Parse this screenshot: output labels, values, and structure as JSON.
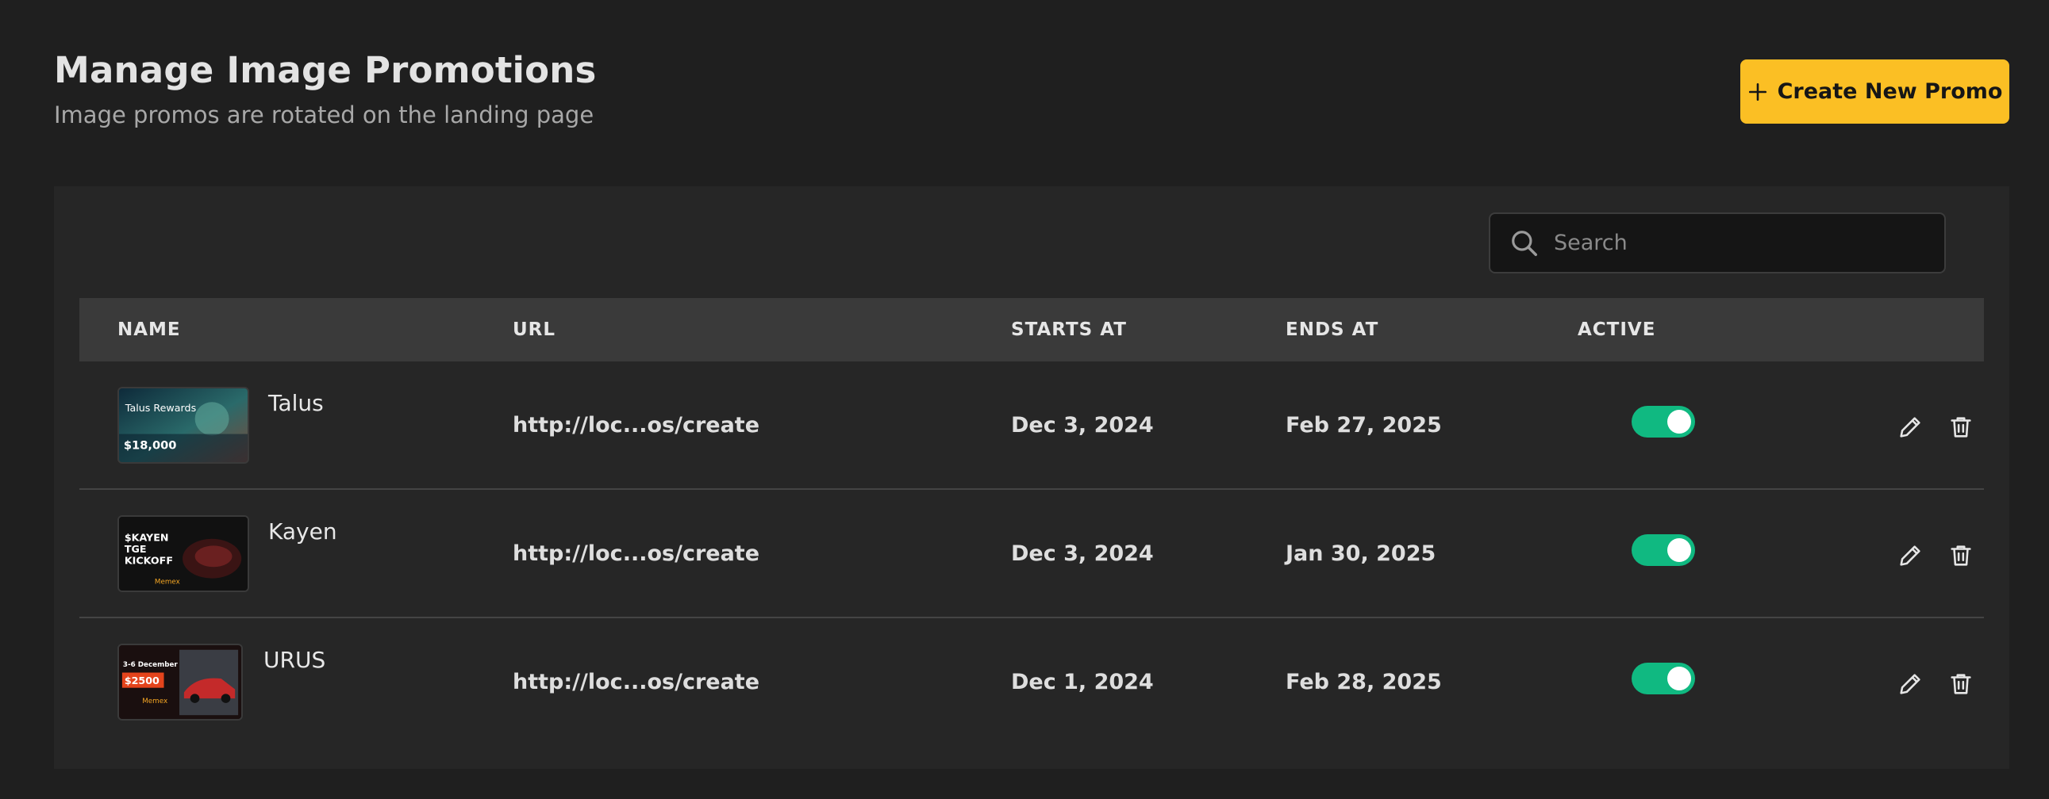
{
  "header": {
    "title": "Manage Image Promotions",
    "subtitle": "Image promos are rotated on the landing page"
  },
  "actions": {
    "create_label": "Create New Promo"
  },
  "search": {
    "placeholder": "Search",
    "value": ""
  },
  "table": {
    "columns": [
      "NAME",
      "URL",
      "STARTS AT",
      "ENDS AT",
      "ACTIVE"
    ],
    "rows": [
      {
        "name": "Talus",
        "url": "http://loc...os/create",
        "starts_at": "Dec 3, 2024",
        "ends_at": "Feb 27, 2025",
        "active": true,
        "thumb": {
          "title": "Talus Rewards",
          "amount": "$18,000"
        }
      },
      {
        "name": "Kayen",
        "url": "http://loc...os/create",
        "starts_at": "Dec 3, 2024",
        "ends_at": "Jan 30, 2025",
        "active": true,
        "thumb": {
          "lines": [
            "$KAYEN",
            "TGE",
            "KICKOFF"
          ],
          "brand": "Memex"
        }
      },
      {
        "name": "URUS",
        "url": "http://loc...os/create",
        "starts_at": "Dec 1, 2024",
        "ends_at": "Feb 28, 2025",
        "active": true,
        "thumb": {
          "date": "3-6 December",
          "amount": "$2500",
          "brand": "Memex"
        }
      }
    ]
  },
  "colors": {
    "background": "#1f1f1f",
    "panel": "#262626",
    "table_header": "#3a3a3a",
    "accent": "#fbbf24",
    "toggle_on": "#10b981"
  },
  "icons": {
    "create": "plus-icon",
    "search": "search-icon",
    "edit": "pencil-icon",
    "delete": "trash-icon"
  }
}
